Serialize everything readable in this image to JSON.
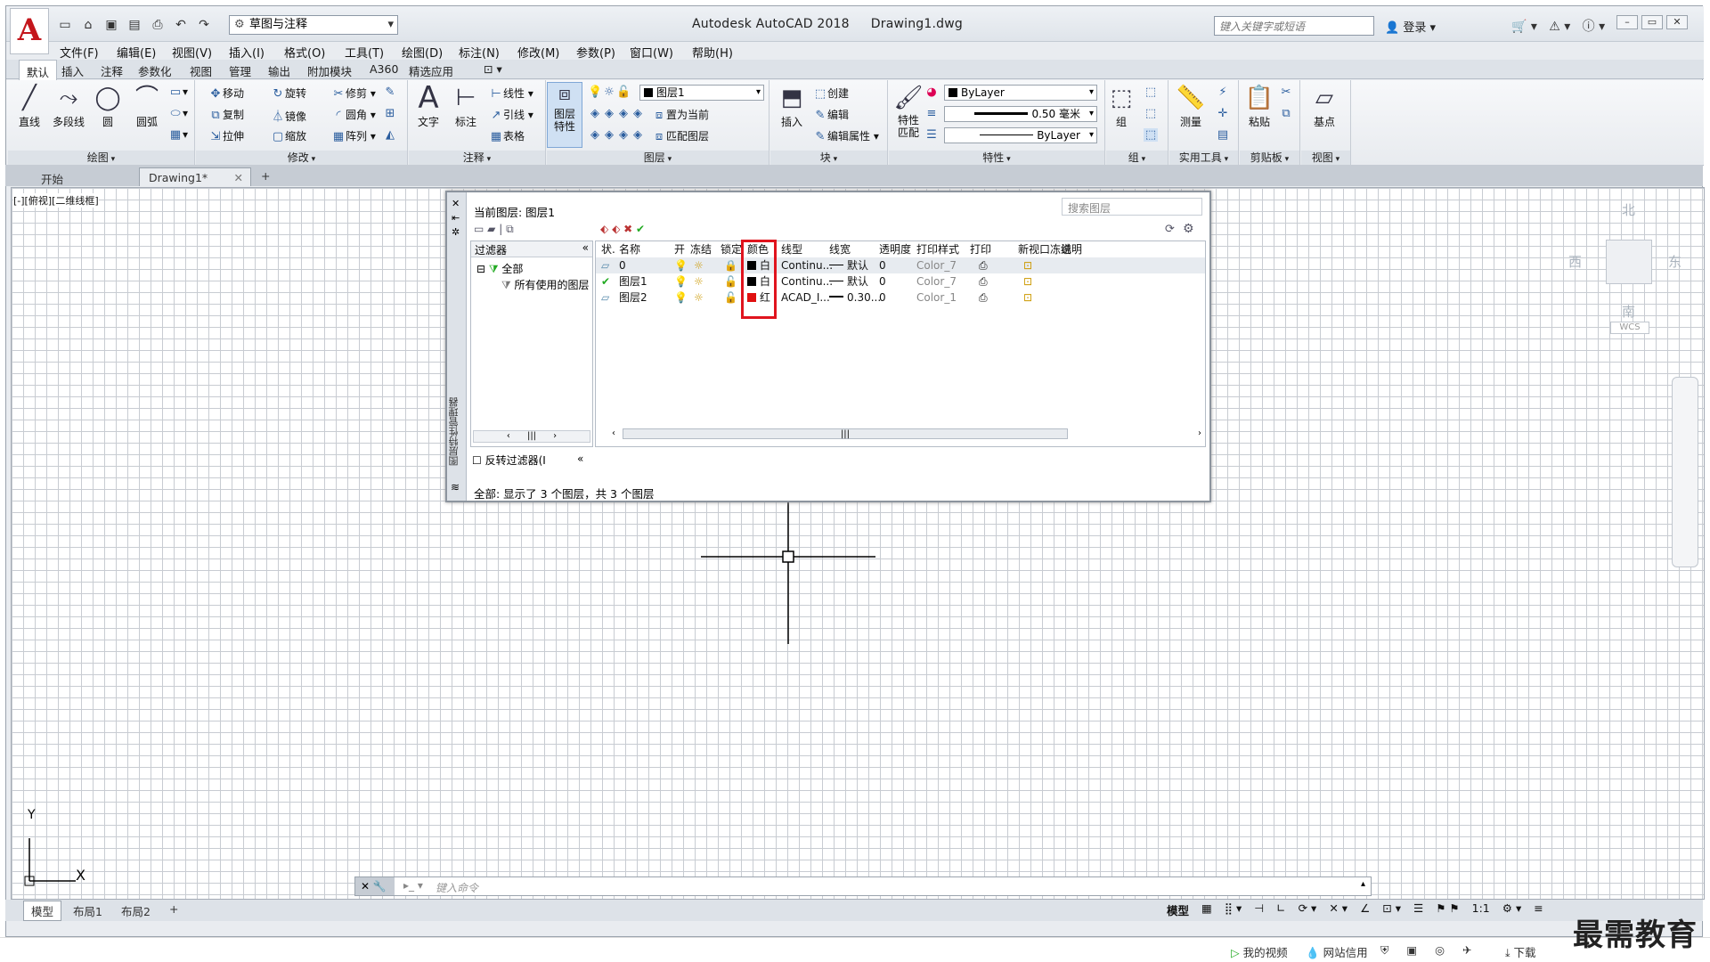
{
  "app": {
    "logo_letter": "A",
    "workspace": "草图与注释",
    "title_app": "Autodesk AutoCAD 2018",
    "title_file": "Drawing1.dwg",
    "search_placeholder": "键入关键字或短语",
    "signin": "登录"
  },
  "menu": [
    "文件(F)",
    "编辑(E)",
    "视图(V)",
    "插入(I)",
    "格式(O)",
    "工具(T)",
    "绘图(D)",
    "标注(N)",
    "修改(M)",
    "参数(P)",
    "窗口(W)",
    "帮助(H)"
  ],
  "ribbon_tabs": [
    "默认",
    "插入",
    "注释",
    "参数化",
    "视图",
    "管理",
    "输出",
    "附加模块",
    "A360",
    "精选应用"
  ],
  "ribbon": {
    "draw": {
      "title": "绘图",
      "line": "直线",
      "polyline": "多段线",
      "circle": "圆",
      "arc": "圆弧"
    },
    "modify": {
      "title": "修改",
      "move": "移动",
      "rotate": "旋转",
      "trim": "修剪",
      "copy": "复制",
      "mirror": "镜像",
      "fillet": "圆角",
      "stretch": "拉伸",
      "scale": "缩放",
      "array": "阵列"
    },
    "annotation": {
      "title": "注释",
      "text": "文字",
      "dimension": "标注",
      "linear": "线性",
      "leader": "引线",
      "table": "表格"
    },
    "layers": {
      "title": "图层",
      "props": "图层\n特性",
      "current_layer": "图层1",
      "set_current": "置为当前",
      "match": "匹配图层"
    },
    "block": {
      "title": "块",
      "insert": "插入",
      "create": "创建",
      "edit": "编辑",
      "edit_attr": "编辑属性"
    },
    "properties": {
      "title": "特性",
      "match": "特性\n匹配",
      "color": "ByLayer",
      "lineweight": "0.50 毫米",
      "linetype": "ByLayer"
    },
    "groups": {
      "title": "组",
      "group": "组"
    },
    "utilities": {
      "title": "实用工具",
      "measure": "测量"
    },
    "clipboard": {
      "title": "剪贴板",
      "paste": "粘贴"
    },
    "view": {
      "title": "视图",
      "base": "基点"
    }
  },
  "doc_tabs": [
    "开始",
    "Drawing1*"
  ],
  "viewport_label": "[-][俯视][二维线框]",
  "viewcube": {
    "n": "北",
    "s": "南",
    "e": "东",
    "w": "西",
    "wcs": "WCS"
  },
  "ucs": {
    "x": "X",
    "y": "Y"
  },
  "layer_manager": {
    "vertical_title": "图层特性管理器",
    "current_layer": "当前图层: 图层1",
    "search_placeholder": "搜索图层",
    "filters_header": "过滤器",
    "filter_all": "全部",
    "filter_used": "所有使用的图层",
    "invert_filter": "反转过滤器(I",
    "columns": [
      "状.",
      "名称",
      "开",
      "冻结",
      "锁定",
      "颜色",
      "线型",
      "线宽",
      "透明度",
      "打印样式",
      "打印",
      "新视口冻结",
      "说明"
    ],
    "rows": [
      {
        "name": "0",
        "color_name": "白",
        "color": "#000000",
        "linetype": "Continu...",
        "lineweight": "默认",
        "transparency": "0",
        "plot_style": "Color_7"
      },
      {
        "name": "图层1",
        "color_name": "白",
        "color": "#000000",
        "linetype": "Continu...",
        "lineweight": "默认",
        "transparency": "0",
        "plot_style": "Color_7"
      },
      {
        "name": "图层2",
        "color_name": "红",
        "color": "#e01010",
        "linetype": "ACAD_I...",
        "lineweight": "0.30...",
        "transparency": "0",
        "plot_style": "Color_1"
      }
    ],
    "footer": "全部: 显示了 3 个图层，共 3 个图层"
  },
  "command_placeholder": "键入命令",
  "layout_tabs": [
    "模型",
    "布局1",
    "布局2"
  ],
  "status": {
    "model": "模型",
    "scale": "1:1"
  },
  "taskbar": {
    "video": "我的视频",
    "credit": "网站信用",
    "download": "下载"
  },
  "watermark": "最需教育"
}
